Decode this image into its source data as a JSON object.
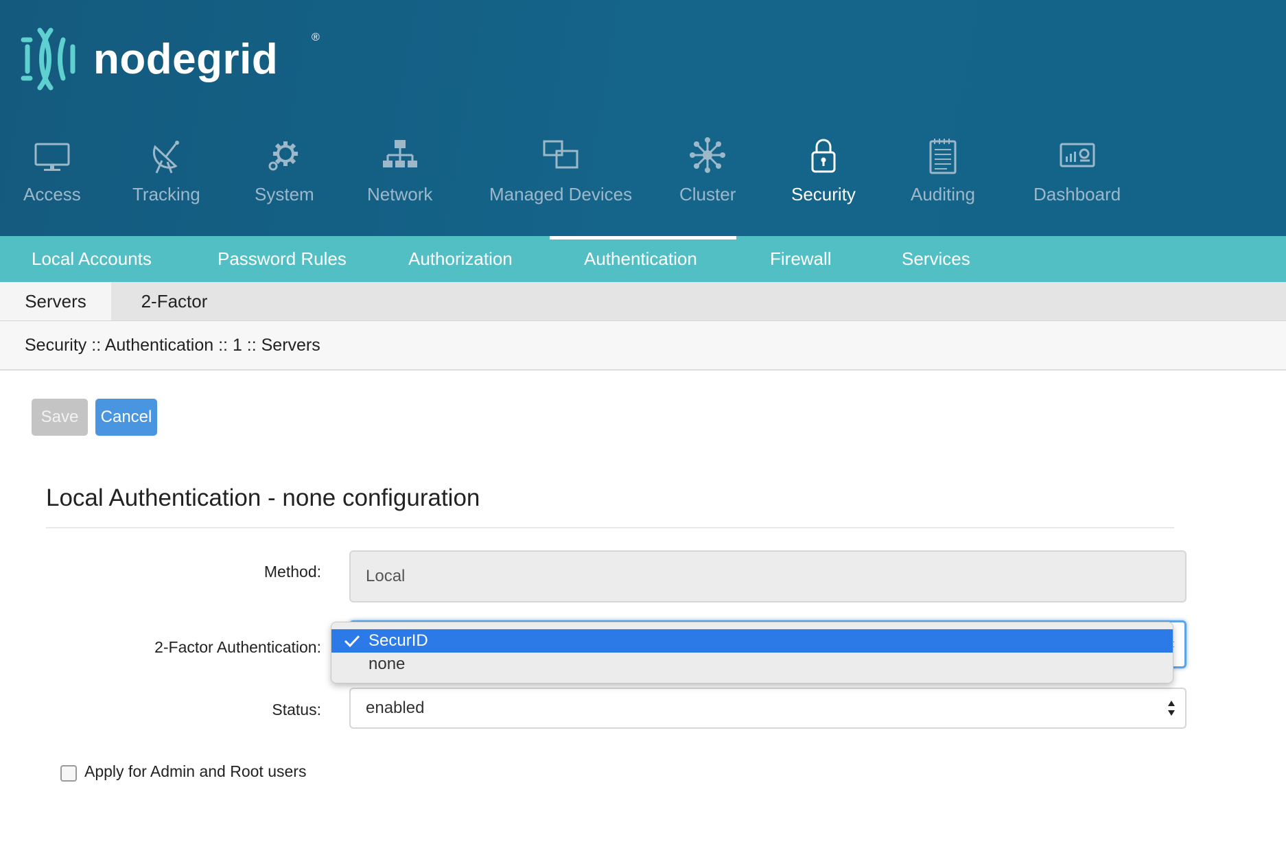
{
  "brand": {
    "name": "nodegrid",
    "registered": "®"
  },
  "main_nav": [
    {
      "label": "Access",
      "icon": "monitor-icon"
    },
    {
      "label": "Tracking",
      "icon": "satellite-icon"
    },
    {
      "label": "System",
      "icon": "gear-icon"
    },
    {
      "label": "Network",
      "icon": "network-icon"
    },
    {
      "label": "Managed Devices",
      "icon": "devices-icon"
    },
    {
      "label": "Cluster",
      "icon": "cluster-icon"
    },
    {
      "label": "Security",
      "icon": "lock-icon",
      "active": true
    },
    {
      "label": "Auditing",
      "icon": "notepad-icon"
    },
    {
      "label": "Dashboard",
      "icon": "dashboard-icon"
    }
  ],
  "sub_nav": [
    {
      "label": "Local Accounts"
    },
    {
      "label": "Password Rules"
    },
    {
      "label": "Authorization"
    },
    {
      "label": "Authentication",
      "active": true
    },
    {
      "label": "Firewall"
    },
    {
      "label": "Services"
    }
  ],
  "tabs": [
    {
      "label": "Servers",
      "active": true
    },
    {
      "label": "2-Factor"
    }
  ],
  "breadcrumb": "Security :: Authentication :: 1 :: Servers",
  "buttons": {
    "save": "Save",
    "cancel": "Cancel"
  },
  "form": {
    "title": "Local Authentication - none configuration",
    "method": {
      "label": "Method:",
      "value": "Local"
    },
    "two_factor": {
      "label": "2-Factor Authentication:",
      "options": [
        "SecurID",
        "none"
      ],
      "selected": "SecurID"
    },
    "status": {
      "label": "Status:",
      "value": "enabled"
    },
    "apply_admin": {
      "label": "Apply for Admin and Root users",
      "checked": false
    }
  },
  "colors": {
    "header": "#15658b",
    "subnav": "#52bfc5",
    "cancel_button": "#4a95df",
    "dropdown_highlight": "#2c7ae8"
  }
}
